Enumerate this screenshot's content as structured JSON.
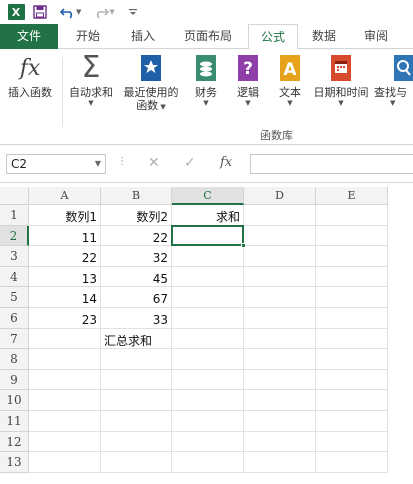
{
  "titlebar": {
    "icons": [
      "excel-logo",
      "save-icon",
      "undo-icon",
      "redo-icon",
      "customize-icon"
    ],
    "logo_text": "X"
  },
  "tabs": [
    {
      "label": "文件",
      "active": false
    },
    {
      "label": "开始",
      "active": false
    },
    {
      "label": "插入",
      "active": false
    },
    {
      "label": "页面布局",
      "active": false
    },
    {
      "label": "公式",
      "active": true
    },
    {
      "label": "数据",
      "active": false
    },
    {
      "label": "审阅",
      "active": false
    }
  ],
  "ribbon": {
    "buttons": [
      {
        "label": "插入函数",
        "label2": "",
        "icon": "fx-icon"
      },
      {
        "label": "自动求和",
        "label2": "",
        "icon": "sigma-icon"
      },
      {
        "label": "最近使用的",
        "label2": "函数",
        "icon": "star-book-icon"
      },
      {
        "label": "财务",
        "label2": "",
        "icon": "coins-book-icon"
      },
      {
        "label": "逻辑",
        "label2": "",
        "icon": "question-book-icon"
      },
      {
        "label": "文本",
        "label2": "",
        "icon": "text-book-icon"
      },
      {
        "label": "日期和时间",
        "label2": "",
        "icon": "calendar-book-icon"
      },
      {
        "label": "查找与",
        "label2": "",
        "icon": "lookup-book-icon"
      }
    ],
    "group_label": "函数库"
  },
  "formula_bar": {
    "name_box": "C2",
    "formula": ""
  },
  "sheet": {
    "columns": [
      "A",
      "B",
      "C",
      "D",
      "E"
    ],
    "selected_column": "C",
    "rows": [
      "1",
      "2",
      "3",
      "4",
      "5",
      "6",
      "7",
      "8",
      "9",
      "10",
      "11",
      "12",
      "13"
    ],
    "selected_row": "2",
    "cells": {
      "A1": "数列1",
      "B1": "数列2",
      "C1": "求和",
      "A2": "11",
      "B2": "22",
      "A3": "22",
      "B3": "32",
      "A4": "13",
      "B4": "45",
      "A5": "14",
      "B5": "67",
      "A6": "23",
      "B6": "33",
      "B7": "汇总求和"
    }
  },
  "colors": {
    "accent": "#217346",
    "header_bg": "#f3f3f3",
    "gridline": "#e1e1e1"
  }
}
